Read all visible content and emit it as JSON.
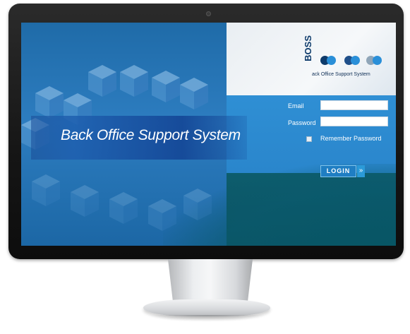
{
  "banner": {
    "title": "Back Office Support System"
  },
  "logo": {
    "letters": "BOSS",
    "tagline": "ack Office Support System",
    "dot_colors": [
      "#0e3b6b",
      "#2a8fd8",
      "#1f4f8a",
      "#2a8fd8",
      "#8fa5b8",
      "#2a8fd8"
    ]
  },
  "login_form": {
    "email_label": "Email",
    "email_value": "",
    "password_label": "Password",
    "password_value": "",
    "remember_label": "Remember Password",
    "remember_checked": false,
    "login_button": "LOGIN",
    "login_arrow": "»"
  },
  "colors": {
    "screen_blue": "#2d7dc0",
    "band_blue": "#2f8fd4",
    "teal": "#0d5d6d",
    "bezel": "#151515"
  }
}
